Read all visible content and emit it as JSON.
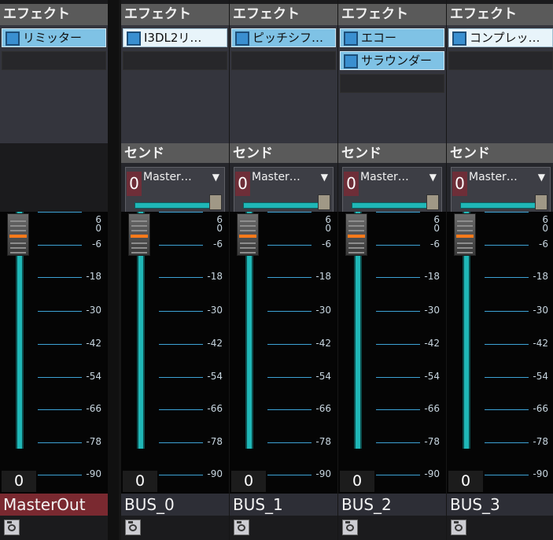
{
  "colors": {
    "teal": "#1fb7b7",
    "orange": "#ff7a1a",
    "fx_slot": "#7fc2e5",
    "master_name": "#7a2930",
    "send_num": "#6e2e38"
  },
  "headers": {
    "effect": "エフェクト",
    "send": "センド"
  },
  "scale": [
    "6",
    "0",
    "-6",
    "-18",
    "-30",
    "-42",
    "-54",
    "-66",
    "-78",
    "-90"
  ],
  "channels": [
    {
      "name": "MasterOut",
      "value": "0",
      "effects": [
        "リミッター",
        ""
      ],
      "send": null
    },
    {
      "name": "BUS_0",
      "value": "0",
      "effects": [
        "I3DL2リ…",
        ""
      ],
      "send": {
        "level": "0",
        "dest": "Master…"
      }
    },
    {
      "name": "BUS_1",
      "value": "0",
      "effects": [
        "ピッチシフ…",
        ""
      ],
      "send": {
        "level": "0",
        "dest": "Master…"
      }
    },
    {
      "name": "BUS_2",
      "value": "0",
      "effects": [
        "エコー",
        "サラウンダー",
        ""
      ],
      "send": {
        "level": "0",
        "dest": "Master…"
      }
    },
    {
      "name": "BUS_3",
      "value": "0",
      "effects": [
        "コンプレッ…",
        ""
      ],
      "send": {
        "level": "0",
        "dest": "Master…"
      }
    }
  ]
}
